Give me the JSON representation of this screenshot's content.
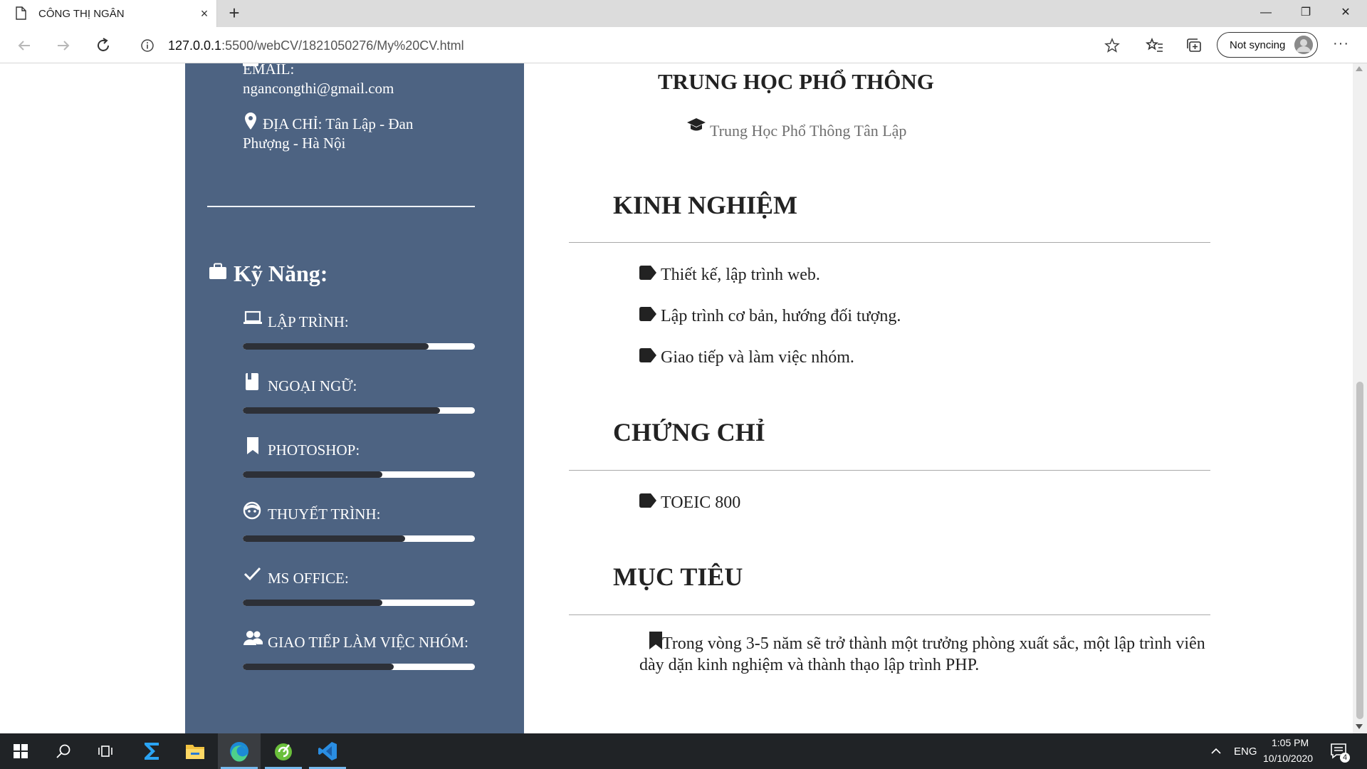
{
  "browser": {
    "tab_title": "CÔNG THỊ NGÂN",
    "tab_close": "×",
    "new_tab": "+",
    "minimize": "—",
    "restore": "❐",
    "close": "✕",
    "url_host": "127.0.0.1",
    "url_rest": ":5500/webCV/1821050276/My%20CV.html",
    "sync_label": "Not syncing",
    "more_label": "···"
  },
  "sidebar": {
    "email": "EMAIL: ngancongthi@gmail.com",
    "address": "ĐỊA CHỈ: Tân Lập - Đan Phượng - Hà Nội",
    "skills_heading": "Kỹ Năng:",
    "skills": [
      {
        "label": "LẬP TRÌNH:",
        "icon": "laptop-icon",
        "level": 0.8
      },
      {
        "label": "NGOẠI NGỮ:",
        "icon": "book-icon",
        "level": 0.85
      },
      {
        "label": "PHOTOSHOP:",
        "icon": "bookmark-icon",
        "level": 0.6
      },
      {
        "label": "THUYẾT TRÌNH:",
        "icon": "smile-icon",
        "level": 0.7
      },
      {
        "label": "MS OFFICE:",
        "icon": "check-icon",
        "level": 0.6
      },
      {
        "label": "GIAO TIẾP LÀM VIỆC NHÓM:",
        "icon": "users-icon",
        "level": 0.65
      }
    ]
  },
  "main": {
    "school_heading": "TRUNG HỌC PHỔ THÔNG",
    "school_name": "Trung Học Phổ Thông Tân Lập",
    "experience_title": "KINH NGHIỆM",
    "experience": [
      "Thiết kế, lập trình web.",
      "Lập trình cơ bản, hướng đối tượng.",
      "Giao tiếp và làm việc nhóm."
    ],
    "cert_title": "CHỨNG CHỈ",
    "certs": [
      "TOEIC 800"
    ],
    "goal_title": "MỤC TIÊU",
    "goal": "Trong vòng 3-5 năm sẽ trở thành một trưởng phòng xuất sắc, một lập trình viên dày dặn kinh nghiệm và thành thạo lập trình PHP."
  },
  "taskbar": {
    "lang": "ENG",
    "time": "1:05 PM",
    "date": "10/10/2020",
    "notifications": "4"
  },
  "colors": {
    "sidebar_bg": "#4d6382",
    "progress_fill": "#2d3037",
    "taskbar_bg": "#202326"
  }
}
